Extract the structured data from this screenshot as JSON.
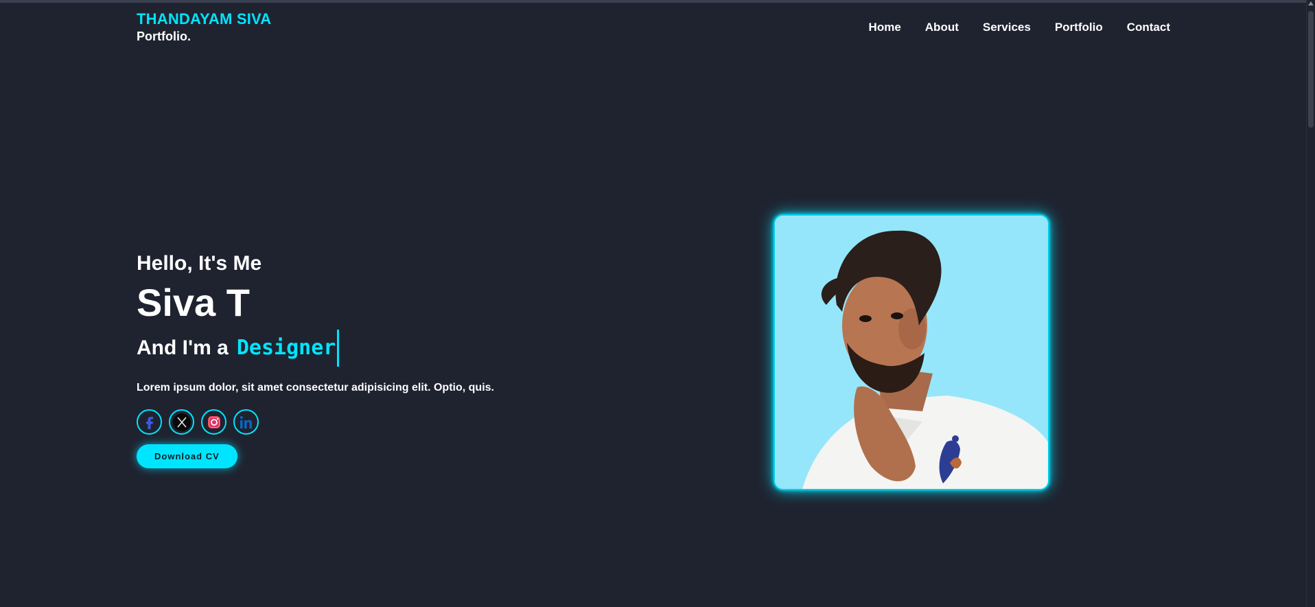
{
  "header": {
    "brand_name": "THANDAYAM SIVA",
    "brand_sub": "Portfolio.",
    "nav": [
      "Home",
      "About",
      "Services",
      "Portfolio",
      "Contact"
    ]
  },
  "hero": {
    "greeting": "Hello, It's Me",
    "name": "Siva T",
    "role_prefix": "And I'm a",
    "role_word": "Designer",
    "description": "Lorem ipsum dolor, sit amet consectetur adipisicing elit. Optio, quis.",
    "socials": [
      "facebook-icon",
      "x-twitter-icon",
      "instagram-icon",
      "linkedin-icon"
    ],
    "cta": "Download CV"
  },
  "colors": {
    "background": "#1f2330",
    "accent": "#00e5ff",
    "photo_background": "#95e6fa"
  }
}
